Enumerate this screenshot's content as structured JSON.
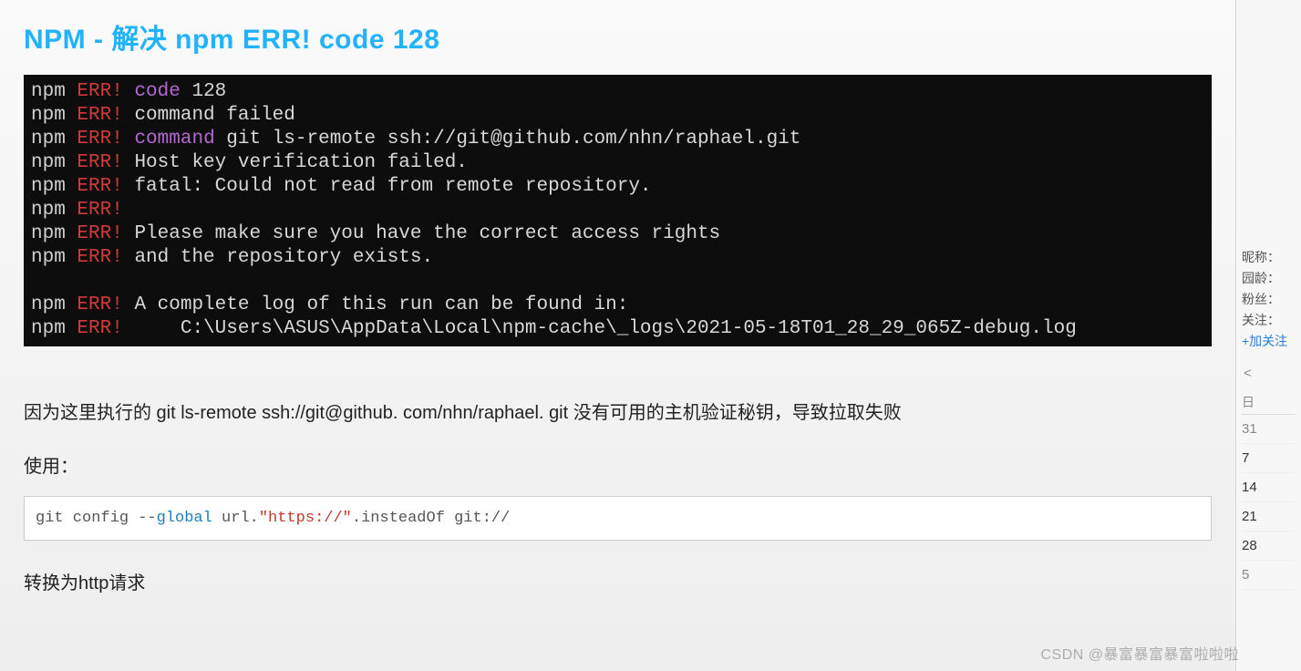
{
  "title": "NPM - 解决 npm ERR! code 128",
  "terminal": {
    "lines": [
      {
        "npm": "npm",
        "err": "ERR!",
        "kw": "code",
        "txt": " 128"
      },
      {
        "npm": "npm",
        "err": "ERR!",
        "kw": "",
        "txt": " command failed"
      },
      {
        "npm": "npm",
        "err": "ERR!",
        "kw": "command",
        "txt": " git ls-remote ssh://git@github.com/nhn/raphael.git"
      },
      {
        "npm": "npm",
        "err": "ERR!",
        "kw": "",
        "txt": " Host key verification failed."
      },
      {
        "npm": "npm",
        "err": "ERR!",
        "kw": "",
        "txt": " fatal: Could not read from remote repository."
      },
      {
        "npm": "npm",
        "err": "ERR!",
        "kw": "",
        "txt": ""
      },
      {
        "npm": "npm",
        "err": "ERR!",
        "kw": "",
        "txt": " Please make sure you have the correct access rights"
      },
      {
        "npm": "npm",
        "err": "ERR!",
        "kw": "",
        "txt": " and the repository exists."
      },
      {
        "blank": " "
      },
      {
        "npm": "npm",
        "err": "ERR!",
        "kw": "",
        "txt": " A complete log of this run can be found in:"
      },
      {
        "npm": "npm",
        "err": "ERR!",
        "kw": "",
        "txt": "     C:\\Users\\ASUS\\AppData\\Local\\npm-cache\\_logs\\2021-05-18T01_28_29_065Z-debug.log"
      }
    ]
  },
  "body": {
    "explanation": "因为这里执行的 git ls-remote ssh://git@github. com/nhn/raphael. git 没有可用的主机验证秘钥，导致拉取失败",
    "use_label": "使用：",
    "code": {
      "p1": "git config --",
      "p2": "global",
      "p3": " url.",
      "p4": "\"https://\"",
      "p5": ".insteadOf git:",
      "p6": "//"
    },
    "convert": "转换为http请求"
  },
  "sidebar": {
    "nick_label": "昵称：",
    "age_label": "园龄：",
    "fans_label": "粉丝：",
    "follow_label": "关注：",
    "add_follow": "+加关注",
    "nav_prev": "<",
    "cal_header_sun": "日",
    "weeks": [
      "31",
      "7",
      "14",
      "21",
      "28",
      "5"
    ]
  },
  "watermark": "CSDN @暴富暴富暴富啦啦啦"
}
